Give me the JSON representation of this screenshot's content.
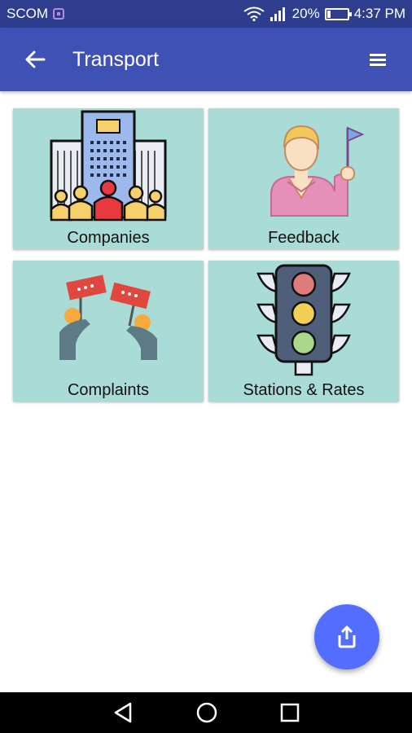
{
  "status_bar": {
    "carrier": "SCOM",
    "battery": "20%",
    "battery_level": 0.2,
    "time": "4:37 PM",
    "icons": [
      "carrier-sim-icon",
      "wifi-icon",
      "signal-icon",
      "battery-icon"
    ]
  },
  "app_bar": {
    "title": "Transport",
    "back_icon": "arrow-left-icon",
    "menu_icon": "menu-icon",
    "color": "#3f51b5"
  },
  "tiles": [
    {
      "label": "Companies",
      "icon": "companies-icon"
    },
    {
      "label": "Feedback",
      "icon": "feedback-icon"
    },
    {
      "label": "Complaints",
      "icon": "complaints-icon"
    },
    {
      "label": "Stations & Rates",
      "icon": "traffic-light-icon"
    }
  ],
  "tile_color": "#a9dcd7",
  "fab": {
    "icon": "share-icon",
    "color": "#536dfe"
  },
  "nav_bar": {
    "icons": [
      "back-triangle-icon",
      "home-circle-icon",
      "recents-square-icon"
    ]
  }
}
